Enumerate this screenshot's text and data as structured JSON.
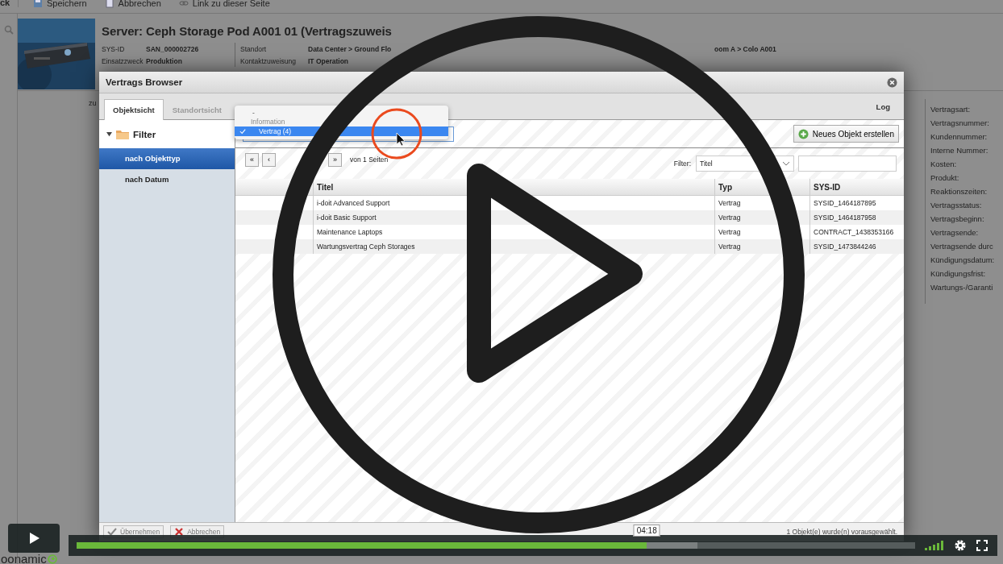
{
  "toolbar": {
    "back_label": "ck",
    "items": [
      {
        "label": "Speichern"
      },
      {
        "label": "Abbrechen"
      },
      {
        "label": "Link zu dieser Seite"
      }
    ]
  },
  "server": {
    "title": "Server: Ceph Storage Pod A001 01 (Vertragszuweis",
    "fields_left": [
      {
        "label": "SYS-ID",
        "value": "SAN_000002726"
      },
      {
        "label": "Einsatzzweck",
        "value": "Produktion"
      }
    ],
    "fields_right": [
      {
        "label": "Standort",
        "value": "Data Center > Ground Flo",
        "value_tail": "oom A > Colo A001"
      },
      {
        "label": "Kontaktzuweisung",
        "value": "IT Operation"
      }
    ]
  },
  "background_note": "zu",
  "right_panel": {
    "labels": [
      "Vertragsart:",
      "Vertragsnummer:",
      "Kundennummer:",
      "Interne Nummer:",
      "Kosten:",
      "Produkt:",
      "Reaktionszeiten:",
      "Vertragsstatus:",
      "Vertragsbeginn:",
      "Vertragsende:",
      "Vertragsende durc",
      "Kündigungsdatum:",
      "Kündigungsfrist:",
      "Wartungs-/Garanti"
    ]
  },
  "modal": {
    "title": "Vertrags Browser",
    "tabs": [
      {
        "label": "Objektsicht",
        "selected": true
      },
      {
        "label": "Standortsicht",
        "selected": false
      }
    ],
    "log_label": "Log",
    "filter_title": "Filter",
    "sidebar_items": [
      {
        "label": "nach Objekttyp",
        "selected": true
      },
      {
        "label": "nach Datum",
        "selected": false
      }
    ],
    "type_select": {
      "options": [
        {
          "label": "-",
          "kind": "option",
          "selected": false
        },
        {
          "label": "Information",
          "kind": "group",
          "selected": false
        },
        {
          "label": "Vertrag (4)",
          "kind": "option",
          "selected": true
        }
      ]
    },
    "new_button": "Neues Objekt erstellen",
    "pager_buttons": [
      "«",
      "‹",
      "»"
    ],
    "pager_text": "von 1 Seiten",
    "filter_label": "Filter:",
    "filter_select": "Titel",
    "columns": [
      "Titel",
      "Typ",
      "SYS-ID"
    ],
    "rows": [
      {
        "titel": "i-doit Advanced Support",
        "typ": "Vertrag",
        "sys_id": "SYSID_1464187895"
      },
      {
        "titel": "i-doit Basic Support",
        "typ": "Vertrag",
        "sys_id": "SYSID_1464187958"
      },
      {
        "titel": "Maintenance Laptops",
        "typ": "Vertrag",
        "sys_id": "CONTRACT_1438353166"
      },
      {
        "titel": "Wartungsvertrag Ceph Storages",
        "typ": "Vertrag",
        "sys_id": "SYSID_1473844246"
      }
    ],
    "footer_buttons": [
      "Übernehmen",
      "Abbrechen"
    ],
    "status": "1 Objekt(e) wurde(n) vorausgewählt."
  },
  "video": {
    "progress": {
      "level": 0.68
    },
    "buffered": {
      "level": 0.74
    },
    "time": "04:18",
    "brand": "oonamic"
  }
}
